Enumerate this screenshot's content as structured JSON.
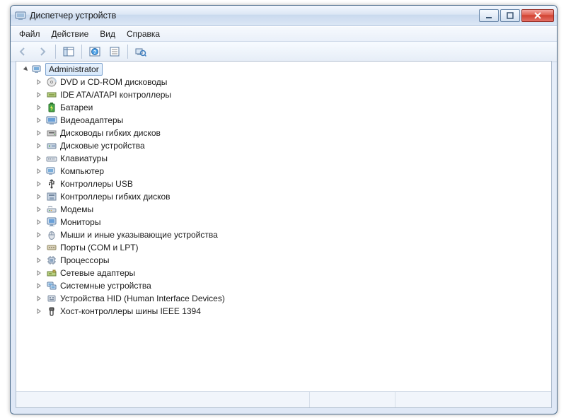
{
  "title": "Диспетчер устройств",
  "menu": {
    "file": "Файл",
    "action": "Действие",
    "view": "Вид",
    "help": "Справка"
  },
  "toolbar": {
    "back": "back",
    "forward": "forward",
    "show_hide": "show-hide-console-tree",
    "help": "help",
    "properties": "properties",
    "scan": "scan-hardware"
  },
  "tree": {
    "root": {
      "label": "Administrator",
      "icon": "computer"
    },
    "items": [
      {
        "label": "DVD и CD-ROM дисководы",
        "icon": "disc"
      },
      {
        "label": "IDE ATA/ATAPI контроллеры",
        "icon": "ide"
      },
      {
        "label": "Батареи",
        "icon": "battery"
      },
      {
        "label": "Видеоадаптеры",
        "icon": "display"
      },
      {
        "label": "Дисководы гибких дисков",
        "icon": "floppy-drive"
      },
      {
        "label": "Дисковые устройства",
        "icon": "hdd"
      },
      {
        "label": "Клавиатуры",
        "icon": "keyboard"
      },
      {
        "label": "Компьютер",
        "icon": "computer"
      },
      {
        "label": "Контроллеры USB",
        "icon": "usb"
      },
      {
        "label": "Контроллеры гибких дисков",
        "icon": "floppy-ctrl"
      },
      {
        "label": "Модемы",
        "icon": "modem"
      },
      {
        "label": "Мониторы",
        "icon": "monitor"
      },
      {
        "label": "Мыши и иные указывающие устройства",
        "icon": "mouse"
      },
      {
        "label": "Порты (COM и LPT)",
        "icon": "port"
      },
      {
        "label": "Процессоры",
        "icon": "cpu"
      },
      {
        "label": "Сетевые адаптеры",
        "icon": "network"
      },
      {
        "label": "Системные устройства",
        "icon": "system"
      },
      {
        "label": "Устройства HID (Human Interface Devices)",
        "icon": "hid"
      },
      {
        "label": "Хост-контроллеры шины IEEE 1394",
        "icon": "ieee1394"
      }
    ]
  }
}
